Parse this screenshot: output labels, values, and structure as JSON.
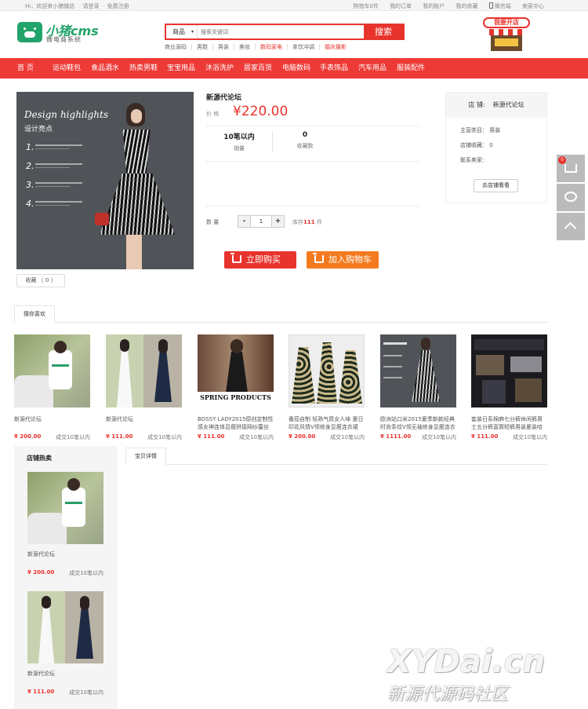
{
  "topbar": {
    "welcome": "Hi，欢迎来小猪微店",
    "login": "请登录",
    "register": "免费注册",
    "cart": "购物车0件",
    "orders": "我的订单",
    "account": "我的账户",
    "favorites": "我的收藏",
    "wechat": "微信端",
    "seller": "卖家中心"
  },
  "logo": {
    "name": "小猪cms",
    "tagline": "微电商系统"
  },
  "search": {
    "category": "商品",
    "placeholder": "搜索关键词",
    "button": "搜索",
    "hotwords": [
      "商业源码",
      "男鞋",
      "男装",
      "美妆",
      "数码家电",
      "茶饮冲调",
      "婚庆摄影"
    ]
  },
  "promo": {
    "label": "我要开店"
  },
  "nav": [
    "首 页",
    "运动鞋包",
    "食品酒水",
    "热卖男鞋",
    "宝宝用品",
    "沐浴洗护",
    "居家百货",
    "电脑数码",
    "手表饰品",
    "汽车用品",
    "服装配件"
  ],
  "product": {
    "image_title": "Design highlights",
    "image_subtitle": "设计亮点",
    "name": "新源代论坛",
    "price_label": "价 格",
    "price": "¥220.00",
    "sales_value": "10笔以内",
    "sales_label": "销量",
    "fav_value": "0",
    "fav_label": "收藏数",
    "qty_label": "数 量",
    "qty": "1",
    "stock_prefix": "库存",
    "stock_count": "111",
    "stock_suffix": "件",
    "buy_label": "立即购买",
    "cart_label": "加入购物车",
    "fav_button": "收藏 （ 0 ）"
  },
  "store": {
    "label": "店 铺:",
    "name": "新源代论坛",
    "main_category": "主营类目： 男装",
    "fav_count": "店铺收藏： 0",
    "contact": "联系卖家:",
    "visit": "去店铺看看"
  },
  "side": {
    "cart_count": "0"
  },
  "guess": {
    "tab": "猜你喜欢",
    "items": [
      {
        "name": "新源代论坛",
        "price": "¥ 200.00",
        "sold": "成交10笔以内"
      },
      {
        "name": "新源代论坛",
        "price": "¥ 111.00",
        "sold": "成交10笔以内"
      },
      {
        "name": "BOSSY LADY2015原创定制性感女神连体显瘦拼接网纱蕾丝长",
        "price": "¥ 111.00",
        "sold": "成交10笔以内",
        "img_text": "SPRING PRODUCTS"
      },
      {
        "name": "番茄自制 轻熟气质女人味 夏日印花风情V领修身显瘦连衣裙 送",
        "price": "¥ 200.00",
        "sold": "成交10笔以内"
      },
      {
        "name": "欧洲站口米2015夏季新款经典时尚条纹V领无袖修身显瘦连衣",
        "price": "¥ 1111.00",
        "sold": "成交10笔以内"
      },
      {
        "name": "套装日系棉麻七分裤休闲裤男士五分裤直筒短裤男装夏装哈伦裤",
        "price": "¥ 111.00",
        "sold": "成交10笔以内"
      }
    ]
  },
  "hot": {
    "title": "店铺热卖",
    "items": [
      {
        "name": "新源代论坛",
        "price": "¥ 200.00",
        "sold": "成交10笔以内"
      },
      {
        "name": "新源代论坛",
        "price": "¥ 111.00",
        "sold": "成交10笔以内"
      }
    ]
  },
  "detail": {
    "tab": "宝贝详情"
  },
  "watermark": {
    "line1": "XYDai.cn",
    "line2": "新源代源码社区"
  }
}
